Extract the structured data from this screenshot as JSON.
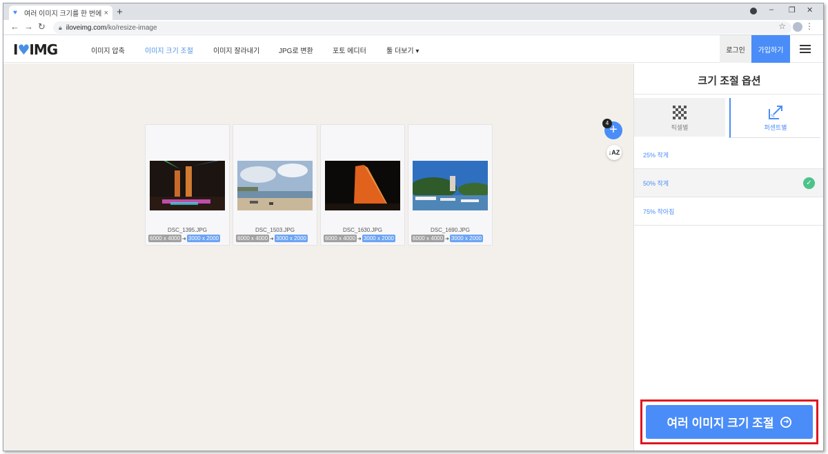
{
  "browser": {
    "tab_title": "여러 이미지 크기를 한 번에 조정",
    "tab_close": "×",
    "new_tab": "+",
    "url_host": "iloveimg.com",
    "url_path": "/ko/resize-image",
    "min": "–",
    "max": "❐",
    "close": "✕",
    "back": "←",
    "forward": "→",
    "reload": "↻",
    "star": "☆",
    "kebab": "⋮"
  },
  "header": {
    "logo_left": "I",
    "logo_heart": "♥",
    "logo_right": "IMG",
    "nav": [
      {
        "label": "이미지 압축"
      },
      {
        "label": "이미지 크기 조절"
      },
      {
        "label": "이미지 잘라내기"
      },
      {
        "label": "JPG로 변환"
      },
      {
        "label": "포토 에디터"
      },
      {
        "label": "툴 더보기 ▾"
      }
    ],
    "login": "로그인",
    "signup": "가입하기"
  },
  "workarea": {
    "file_count": "4",
    "add": "+",
    "sort": "↓AZ",
    "files": [
      {
        "name": "DSC_1395.JPG",
        "original": "6000 x 4000",
        "arrow": "➜",
        "resized": "3000 x 2000"
      },
      {
        "name": "DSC_1503.JPG",
        "original": "6000 x 4000",
        "arrow": "➜",
        "resized": "3000 x 2000"
      },
      {
        "name": "DSC_1630.JPG",
        "original": "6000 x 4000",
        "arrow": "➜",
        "resized": "3000 x 2000"
      },
      {
        "name": "DSC_1690.JPG",
        "original": "6000 x 4000",
        "arrow": "➜",
        "resized": "3000 x 2000"
      }
    ]
  },
  "sidebar": {
    "title": "크기 조절 옵션",
    "tabs": [
      {
        "label": "픽셀별"
      },
      {
        "label": "퍼센트별"
      }
    ],
    "options": [
      {
        "label": "25% 작게"
      },
      {
        "label": "50% 작게"
      },
      {
        "label": "75% 작아짐"
      }
    ],
    "selected_check": "✓",
    "cta": "여러 이미지 크기 조절",
    "cta_icon": "➜"
  },
  "colors": {
    "accent": "#4a8df8",
    "highlight": "#e0141e",
    "check": "#4cc38a",
    "workarea_bg": "#f3f0ec"
  }
}
